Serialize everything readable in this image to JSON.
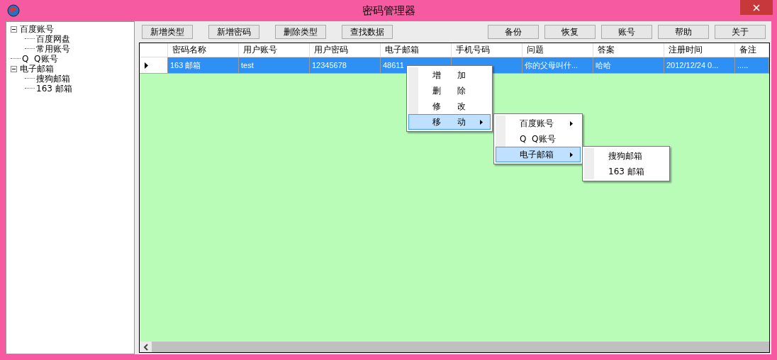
{
  "window": {
    "title": "密码管理器"
  },
  "tree": [
    {
      "label": "百度账号",
      "expanded": true,
      "children": [
        {
          "label": "百度网盘"
        },
        {
          "label": "常用账号"
        }
      ]
    },
    {
      "label": "Q  Q账号"
    },
    {
      "label": "电子邮箱",
      "expanded": true,
      "children": [
        {
          "label": "搜狗邮箱"
        },
        {
          "label": "163 邮箱"
        }
      ]
    }
  ],
  "toolbar_left": [
    "新增类型",
    "新增密码",
    "删除类型",
    "查找数据"
  ],
  "toolbar_right": [
    "备份",
    "恢复",
    "账号",
    "帮助",
    "关于"
  ],
  "table": {
    "columns": [
      "密码名称",
      "用户账号",
      "用户密码",
      "电子邮箱",
      "手机号码",
      "问题",
      "答案",
      "注册时间",
      "备注"
    ],
    "rows": [
      {
        "selected": true,
        "cells": [
          "163 邮箱",
          "test",
          "12345678",
          "48611",
          "",
          "你的父母叫什...",
          "哈哈",
          "2012/12/24 0...",
          "....."
        ]
      }
    ]
  },
  "context_menu": {
    "items": [
      {
        "label": "增 加",
        "selected": false,
        "submenu": false
      },
      {
        "label": "删 除",
        "selected": false,
        "submenu": false
      },
      {
        "label": "修 改",
        "selected": false,
        "submenu": false
      },
      {
        "label": "移 动",
        "selected": true,
        "submenu": true
      }
    ]
  },
  "submenu": {
    "items": [
      {
        "label": "百度账号",
        "selected": false,
        "submenu": true
      },
      {
        "label": "Q  Q账号",
        "selected": false,
        "submenu": false
      },
      {
        "label": "电子邮箱",
        "selected": true,
        "submenu": true
      }
    ]
  },
  "submenu_2": {
    "items": [
      {
        "label": "搜狗邮箱",
        "selected": false,
        "submenu": false
      },
      {
        "label": "163 邮箱",
        "selected": false,
        "submenu": false
      }
    ]
  }
}
